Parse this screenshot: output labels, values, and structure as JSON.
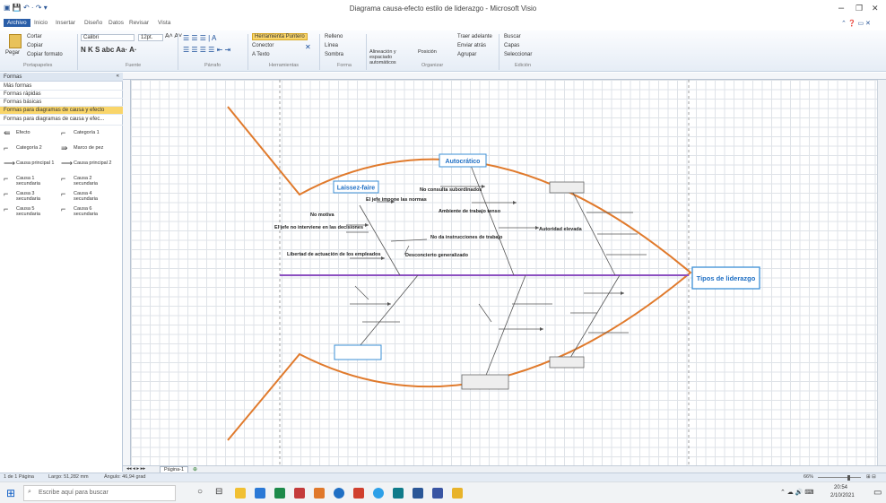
{
  "window": {
    "title": "Diagrama causa-efecto estilo de liderazgo - Microsoft Visio",
    "controls": [
      "–",
      "❐",
      "✕"
    ]
  },
  "menu": {
    "tabs": [
      "Archivo",
      "Inicio",
      "Insertar",
      "Diseño",
      "Datos",
      "Revisar",
      "Vista"
    ]
  },
  "ribbon": {
    "clipboard": {
      "paste": "Pegar",
      "cut": "Cortar",
      "copy": "Copiar",
      "format_painter": "Copiar formato",
      "group": "Portapapeles"
    },
    "font": {
      "family": "Calibri",
      "size": "12pt.",
      "group": "Fuente"
    },
    "paragraph": {
      "group": "Párrafo"
    },
    "tools": {
      "pointer": "Herramienta Puntero",
      "connector": "Conector",
      "text": "A Texto",
      "group": "Herramientas"
    },
    "shape": {
      "fill": "Relleno",
      "line": "Línea",
      "shadow": "Sombra",
      "group": "Forma"
    },
    "arrange": {
      "auto_align": "Alineación y espaciado automáticos",
      "position": "Posición",
      "bring_front": "Traer adelante",
      "send_back": "Enviar atrás",
      "group_btn": "Agrupar",
      "group": "Organizar"
    },
    "editing": {
      "find": "Buscar",
      "layers": "Capas",
      "select": "Seleccionar",
      "group": "Edición"
    }
  },
  "shapes_panel": {
    "header": "Formas",
    "rows": [
      "Más formas",
      "Formas rápidas",
      "Formas básicas",
      "Formas para diagramas de causa y efecto",
      "Formas para diagramas de causa y efec..."
    ],
    "selected_index": 3,
    "stencils": [
      {
        "icon": "⇚",
        "label": "Efecto"
      },
      {
        "icon": "⌐",
        "label": "Categoría 1"
      },
      {
        "icon": "⌐",
        "label": "Categoría 2"
      },
      {
        "icon": "⇛",
        "label": "Marco de pez"
      },
      {
        "icon": "⟶",
        "label": "Causa principal 1"
      },
      {
        "icon": "⟶",
        "label": "Causa principal 2"
      },
      {
        "icon": "⌐",
        "label": "Causa 1 secundaria"
      },
      {
        "icon": "⌐",
        "label": "Causa 2 secundaria"
      },
      {
        "icon": "⌐",
        "label": "Causa 3 secundaria"
      },
      {
        "icon": "⌐",
        "label": "Causa 4 secundaria"
      },
      {
        "icon": "⌐",
        "label": "Causa 5 secundaria"
      },
      {
        "icon": "⌐",
        "label": "Causa 6 secundaria"
      }
    ]
  },
  "diagram": {
    "effect": "Tipos de liderazgo",
    "categories": [
      "Laissez-faire",
      "Autocrático"
    ],
    "laissez_faire_causes": [
      "El jefe impone las normas",
      "No motiva",
      "El jefe no interviene en las decisiones",
      "Libertad de actuación de los empleados",
      "No da instrucciones de trabajo",
      "Desconcierto generalizado"
    ],
    "autocratico_causes": [
      "No consulta subordinados",
      "Ambiente de trabajo tenso",
      "Autoridad elevada"
    ],
    "colors": {
      "fish_outline": "#e07a2c",
      "spine": "#8b4fc0",
      "label_text": "#1f6fc4",
      "label_border": "#3b8fd6"
    }
  },
  "page_bar": {
    "tab": "Página-1"
  },
  "status": {
    "page": "1 de 1 Página",
    "width": "Largo: 51,282 mm",
    "angle": "Ángulo: 46,94 grad",
    "zoom": "66%"
  },
  "taskbar": {
    "search_placeholder": "Escribe aquí para buscar",
    "time": "20:54",
    "date": "2/10/2021"
  }
}
